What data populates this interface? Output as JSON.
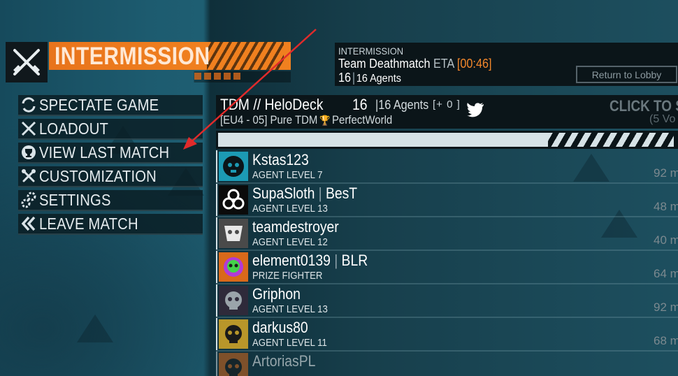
{
  "header": {
    "title": "INTERMISSION",
    "icon": "crossed-rifles-icon"
  },
  "menu": [
    {
      "label": "SPECTATE GAME",
      "icon": "spectate-icon"
    },
    {
      "label": "LOADOUT",
      "icon": "crossed-weapons-icon"
    },
    {
      "label": "VIEW LAST MATCH",
      "icon": "trophy-icon"
    },
    {
      "label": "CUSTOMIZATION",
      "icon": "wrench-screwdriver-icon"
    },
    {
      "label": "SETTINGS",
      "icon": "gears-icon"
    },
    {
      "label": "LEAVE MATCH",
      "icon": "double-chevron-left-icon"
    }
  ],
  "info": {
    "status": "INTERMISSION",
    "mode": "Team Deathmatch",
    "eta_label": "ETA",
    "eta_time": "[00:46]",
    "player_count": "16",
    "agents_label": "16 Agents",
    "lobby_button": "Return to Lobby"
  },
  "server": {
    "name": "TDM // HeloDeck",
    "count": "16",
    "agents": "16 Agents",
    "bonus": "[+ 0 ]",
    "region": "[EU4 - 05] Pure TDM",
    "host": "PerfectWorld",
    "vote_label": "CLICK TO S",
    "vote_sub": "(5 Vo"
  },
  "progress": {
    "fill": 0.72,
    "color": "#d6e2e6"
  },
  "players": [
    {
      "name": "Kstas123",
      "clan": "",
      "level": "AGENT LEVEL 7",
      "ping": "92 m",
      "avatar_bg": "#1c9ab4",
      "avatar_fg": "#0b1519",
      "avatar_icon": "skull-wings-icon"
    },
    {
      "name": "SupaSloth",
      "clan": "BesT",
      "level": "AGENT LEVEL 13",
      "ping": "48 m",
      "avatar_bg": "#0b0b0b",
      "avatar_fg": "#ffffff",
      "avatar_icon": "biohazard-icon"
    },
    {
      "name": "teamdestroyer",
      "clan": "",
      "level": "AGENT LEVEL 12",
      "ping": "40 m",
      "avatar_bg": "#4a4a4a",
      "avatar_fg": "#e8e8e8",
      "avatar_icon": "skull-mask-icon"
    },
    {
      "name": "element0139",
      "clan": "BLR",
      "level": "PRIZE FIGHTER",
      "ping": "64 m",
      "avatar_bg": "#d8691a",
      "avatar_fg": "#b23ad6",
      "avatar_icon": "green-skull-icon"
    },
    {
      "name": "Griphon",
      "clan": "",
      "level": "AGENT LEVEL 13",
      "ping": "92 m",
      "avatar_bg": "#2e2a3a",
      "avatar_fg": "#9aa4aa",
      "avatar_icon": "skull-icon"
    },
    {
      "name": "darkus80",
      "clan": "",
      "level": "AGENT LEVEL 11",
      "ping": "68 m",
      "avatar_bg": "#b8962a",
      "avatar_fg": "#1a1a1a",
      "avatar_icon": "skull-icon"
    },
    {
      "name": "ArtoriasPL",
      "clan": "",
      "level": "",
      "ping": "",
      "avatar_bg": "#d8691a",
      "avatar_fg": "#1a1a1a",
      "avatar_icon": "skull-icon"
    }
  ],
  "colors": {
    "accent": "#f0801f",
    "panel": "#0b1519",
    "annotation_arrow": "#e02b2b"
  }
}
